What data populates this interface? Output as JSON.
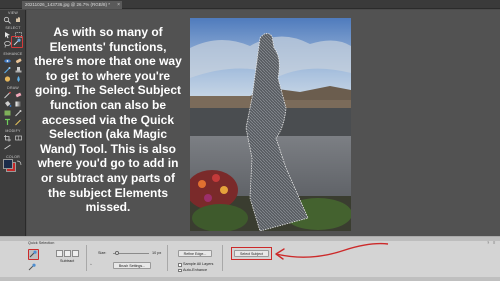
{
  "document_tab": {
    "title": "20211026_143736.jpg @ 26.7% (RGB/8) *",
    "close_glyph": "×"
  },
  "toolbar": {
    "sections": [
      "VIEW",
      "SELECT",
      "ENHANCE",
      "DRAW",
      "MODIFY",
      "COLOR"
    ],
    "active_tool": "quick-selection-tool",
    "foreground_color": "#1b2c4a",
    "background_color": "#c62828"
  },
  "caption": {
    "text": "As with so many of Elements' functions, there's more that one way to get to where you're going. The Select Subject function can also be accessed via the Quick Selection (aka Magic Wand) Tool. This is also where you'd go to add in or subtract any parts of the subject Elements missed."
  },
  "options_bar": {
    "tool_name": "Quick Selection",
    "subtract_label": "Subtract",
    "size_label": "Size:",
    "size_value": "10 px",
    "brush_settings_label": "Brush Settings...",
    "refine_edge_label": "Refine Edge...",
    "sample_all_layers_label": "Sample All Layers",
    "auto_enhance_label": "Auto-Enhance",
    "select_subject_label": "Select Subject",
    "brush_size_fraction": 0.1
  },
  "colors": {
    "annotation_red": "#cc2a2a"
  },
  "icons": {
    "close": "close-icon",
    "quick_selection": "quick-selection-icon",
    "new_selection": "new-selection-icon",
    "add_selection": "add-to-selection-icon",
    "subtract_selection": "subtract-selection-icon",
    "help": "help-icon",
    "menu": "menu-icon"
  }
}
